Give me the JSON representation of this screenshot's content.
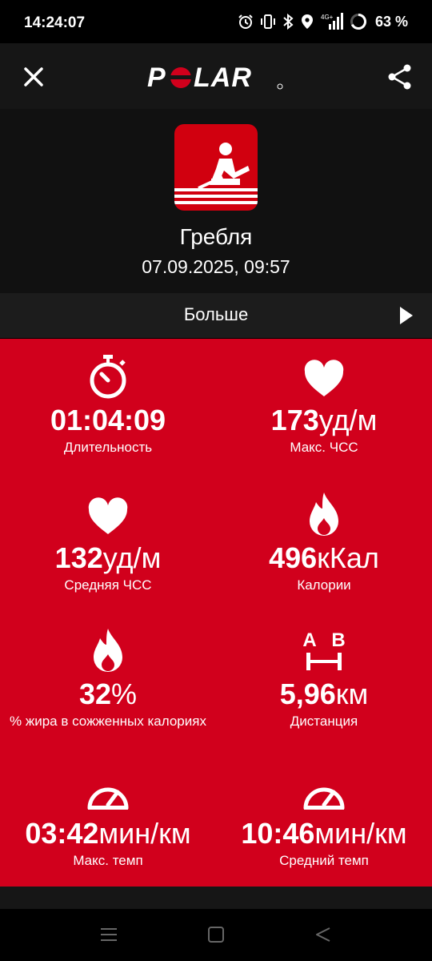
{
  "status_bar": {
    "time": "14:24:07",
    "battery": "63 %",
    "network": "4G+"
  },
  "header": {
    "logo_text": "POLAR"
  },
  "workout": {
    "sport": "Гребля",
    "date": "07.09.2025, 09:57"
  },
  "more": {
    "label": "Больше"
  },
  "stats": {
    "duration": {
      "value": "01:04:09",
      "unit": "",
      "label": "Длительность",
      "icon": "stopwatch-icon"
    },
    "max_hr": {
      "value": "173",
      "unit": "уд/м",
      "label": "Макс. ЧСС",
      "icon": "heart-icon"
    },
    "avg_hr": {
      "value": "132",
      "unit": "уд/м",
      "label": "Средняя ЧСС",
      "icon": "heart-icon"
    },
    "calories": {
      "value": "496",
      "unit": "кКал",
      "label": "Калории",
      "icon": "flame-icon"
    },
    "fat_pct": {
      "value": "32",
      "unit": "%",
      "label": "% жира в сожженных калориях",
      "icon": "flame-icon"
    },
    "distance": {
      "value": "5,96",
      "unit": "км",
      "label": "Дистанция",
      "icon": "distance-ab-icon",
      "icon_a": "A",
      "icon_b": "B"
    },
    "max_pace": {
      "value": "03:42",
      "unit": "мин/км",
      "label": "Макс. темп",
      "icon": "speedometer-icon"
    },
    "avg_pace": {
      "value": "10:46",
      "unit": "мин/км",
      "label": "Средний темп",
      "icon": "speedometer-icon"
    }
  },
  "colors": {
    "accent": "#d1001c",
    "icon_bg": "#d1000f"
  }
}
